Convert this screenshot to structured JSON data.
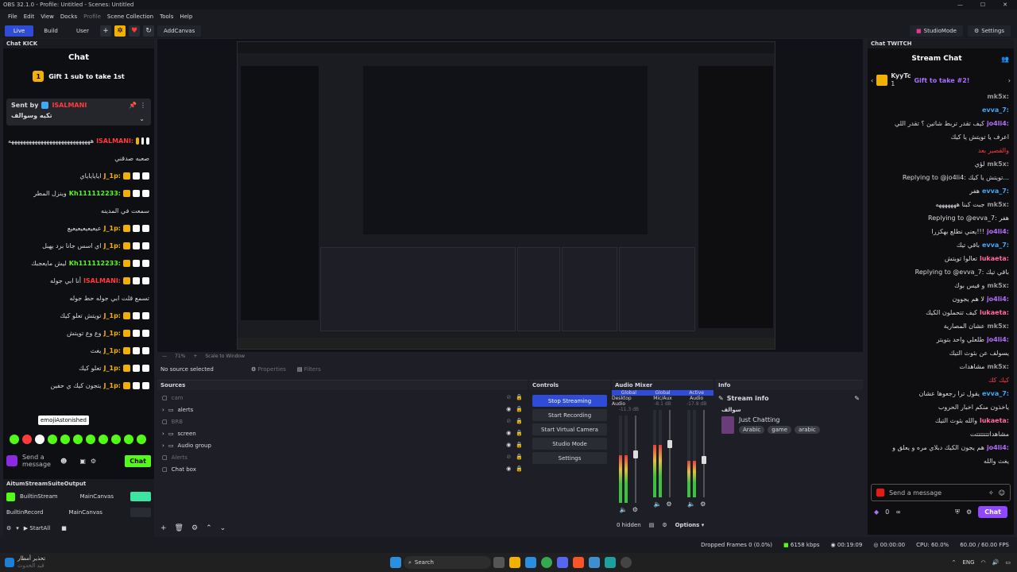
{
  "window": {
    "title": "OBS 32.1.0 - Profile: Untitled - Scenes: Untitled"
  },
  "menu": [
    "File",
    "Edit",
    "View",
    "Docks",
    "Profile",
    "Scene Collection",
    "Tools",
    "Help"
  ],
  "toolbar": {
    "live": "Live",
    "build": "Build",
    "user": "User",
    "add_canvas": "AddCanvas",
    "studio_mode": "StudioMode",
    "settings": "Settings"
  },
  "kick": {
    "dock_title": "Chat KICK",
    "header": "Chat",
    "gift_count": "1",
    "gift_text": "Gift 1 sub to take 1st",
    "pinned_label": "Sent by",
    "pinned_user": "ISALMANI",
    "pinned_msg": "تكيه وسوالف",
    "messages": [
      {
        "user": "ISALMANI:",
        "text": "ههههههههههههههههههههههههههههه",
        "color": "#ff3b3b"
      },
      {
        "user": "",
        "text": "صعبه صدقني",
        "color": ""
      },
      {
        "user": "J_1p:",
        "text": "اياياياياي",
        "color": "#f2b100"
      },
      {
        "user": "Kh111112233:",
        "text": "وينزل المطر",
        "color": "#53fc18"
      },
      {
        "user": "",
        "text": "سمعت في المدينه",
        "color": ""
      },
      {
        "user": "J_1p:",
        "text": "عيعيعيعيعيعيع",
        "color": "#f2b100"
      },
      {
        "user": "J_1p:",
        "text": "اي اسس جانا برد يهبل",
        "color": "#f2b100"
      },
      {
        "user": "Kh111112233:",
        "text": "ليش مايعجبك",
        "color": "#53fc18"
      },
      {
        "user": "ISALMANI:",
        "text": "أنا ابي جوله",
        "color": "#ff3b3b"
      },
      {
        "user": "",
        "text": "تسمع قلت ابي جوله حط جوله",
        "color": ""
      },
      {
        "user": "J_1p:",
        "text": "تويتش تعلو كيك",
        "color": "#f2b100"
      },
      {
        "user": "J_1p:",
        "text": "وع وع تويتش",
        "color": "#f2b100"
      },
      {
        "user": "J_1p:",
        "text": "يغث",
        "color": "#f2b100"
      },
      {
        "user": "J_1p:",
        "text": "تعلو كيك",
        "color": "#f2b100"
      },
      {
        "user": "J_1p:",
        "text": "يتجون كيك ي حفين",
        "color": "#f2b100"
      }
    ],
    "tooltip": "emojiAstonished",
    "input_placeholder": "Send a message",
    "send": "Chat"
  },
  "stream_output": {
    "title": "AitumStreamSuiteOutput",
    "rows": [
      {
        "name": "BuiltinStream",
        "canvas": "MainCanvas"
      },
      {
        "name": "BuiltinRecord",
        "canvas": "MainCanvas"
      }
    ],
    "start_all": "StartAll"
  },
  "preview": {
    "zoom": "71%",
    "scale": "Scale to Window"
  },
  "source_bar": {
    "none": "No source selected",
    "properties": "Properties",
    "filters": "Filters"
  },
  "sources": {
    "title": "Sources",
    "items": [
      {
        "name": "cam",
        "group": false,
        "dim": true
      },
      {
        "name": "alerts",
        "group": true,
        "dim": false
      },
      {
        "name": "BRB",
        "group": false,
        "dim": true
      },
      {
        "name": "screen",
        "group": true,
        "dim": false
      },
      {
        "name": "Audio group",
        "group": true,
        "dim": false
      },
      {
        "name": "Alerts",
        "group": false,
        "dim": true
      },
      {
        "name": "Chat box",
        "group": false,
        "dim": false
      }
    ]
  },
  "controls": {
    "title": "Controls",
    "stop": "Stop Streaming",
    "record": "Start Recording",
    "vcam": "Start Virtual Camera",
    "studio": "Studio Mode",
    "settings": "Settings"
  },
  "mixer": {
    "title": "Audio Mixer",
    "channels": [
      {
        "tag": "Global",
        "name": "Desktop Audio",
        "db": "-11.3 dB",
        "level": 0.55
      },
      {
        "tag": "Global",
        "name": "Mic/Aux",
        "db": "-8.1 dB",
        "level": 0.6
      },
      {
        "tag": "Active",
        "name": "Audio",
        "db": "-17.8 dB",
        "level": 0.42
      }
    ],
    "hidden": "0 hidden",
    "options": "Options"
  },
  "info": {
    "title": "Info",
    "stream_info": "Stream info",
    "category_user": "سوالف",
    "category": "Just Chatting",
    "tags": [
      "Arabic",
      "game",
      "arabic"
    ]
  },
  "twitch": {
    "dock_title": "Chat TWITCH",
    "header": "Stream Chat",
    "pinned_user": "KyyTc",
    "pinned_count": "1",
    "gift_text": "Gift to take #2!",
    "messages": [
      {
        "user": "mk5x:",
        "text": "",
        "color": "#9a9a9a"
      },
      {
        "user": "evva_7:",
        "text": "",
        "color": "#3fa9f5"
      },
      {
        "user": "jo4li4:",
        "text": "كيف تقدر تربط شاتين ؟ تقدر اللي",
        "color": "#b36bff"
      },
      {
        "user": "",
        "text": "اعرف يا تويتش يا كيك",
        "color": ""
      },
      {
        "user": "",
        "text": "والقصير بعد",
        "color": "#ff3b3b"
      },
      {
        "user": "mk5x:",
        "text": "لؤي",
        "color": "#9a9a9a"
      },
      {
        "user": "",
        "text": "Replying to @jo4li4: تويتش يا كيك...",
        "color": ""
      },
      {
        "user": "evva_7:",
        "text": "هفر",
        "color": "#3fa9f5"
      },
      {
        "user": "mk5x:",
        "text": "جبت كبنا هههههههه",
        "color": "#9a9a9a"
      },
      {
        "user": "",
        "text": "Replying to @evva_7: هفر",
        "color": ""
      },
      {
        "user": "jo4li4:",
        "text": "يعني نطلع بهكزرا!!!",
        "color": "#b36bff"
      },
      {
        "user": "evva_7:",
        "text": "باقي تيك",
        "color": "#3fa9f5"
      },
      {
        "user": "lukaeta:",
        "text": "تعالوا تويتش",
        "color": "#ff6b9d"
      },
      {
        "user": "",
        "text": "Replying to @evva_7: باقي تيك",
        "color": ""
      },
      {
        "user": "mk5x:",
        "text": "و فيس بوك",
        "color": "#9a9a9a"
      },
      {
        "user": "jo4li4:",
        "text": "لا هم يجوون",
        "color": "#b36bff"
      },
      {
        "user": "lukaeta:",
        "text": "كيف تتحملون الكيك",
        "color": "#ff6b9d"
      },
      {
        "user": "mk5x:",
        "text": "عشان المصارية",
        "color": "#9a9a9a"
      },
      {
        "user": "jo4li4:",
        "text": "طلعلي واحد بتويتر",
        "color": "#b36bff"
      },
      {
        "user": "",
        "text": "يسولف عن بثوث التيك",
        "color": ""
      },
      {
        "user": "mk5x:",
        "text": "مشاهدات",
        "color": "#9a9a9a"
      },
      {
        "user": "",
        "text": "كيك كك",
        "color": "#ff3b3b"
      },
      {
        "user": "evva_7:",
        "text": "يقول ترا رجعوها عشان",
        "color": "#3fa9f5"
      },
      {
        "user": "",
        "text": "ياخذون منكم اخبار الحروب",
        "color": ""
      },
      {
        "user": "lukaeta:",
        "text": "والله بثوث التيك",
        "color": "#ff6b9d"
      },
      {
        "user": "",
        "text": "مشاهداتتتتتتتت",
        "color": ""
      },
      {
        "user": "jo4li4:",
        "text": "هم يجون الكيك دبلاي مره و يعلق و",
        "color": "#b36bff"
      },
      {
        "user": "",
        "text": "يغث والله",
        "color": ""
      }
    ],
    "input_placeholder": "Send a message",
    "points": "0",
    "send": "Chat"
  },
  "status": {
    "dropped": "Dropped Frames 0 (0.0%)",
    "kbps": "6158 kbps",
    "live_time": "00:19:09",
    "rec_time": "00:00:00",
    "cpu": "CPU: 60.0%",
    "fps": "60.00 / 60.00 FPS"
  },
  "taskbar": {
    "news": "تحذير أمطار",
    "news_sub": "قيد الحدوث",
    "search": "Search",
    "lang": "ENG"
  }
}
